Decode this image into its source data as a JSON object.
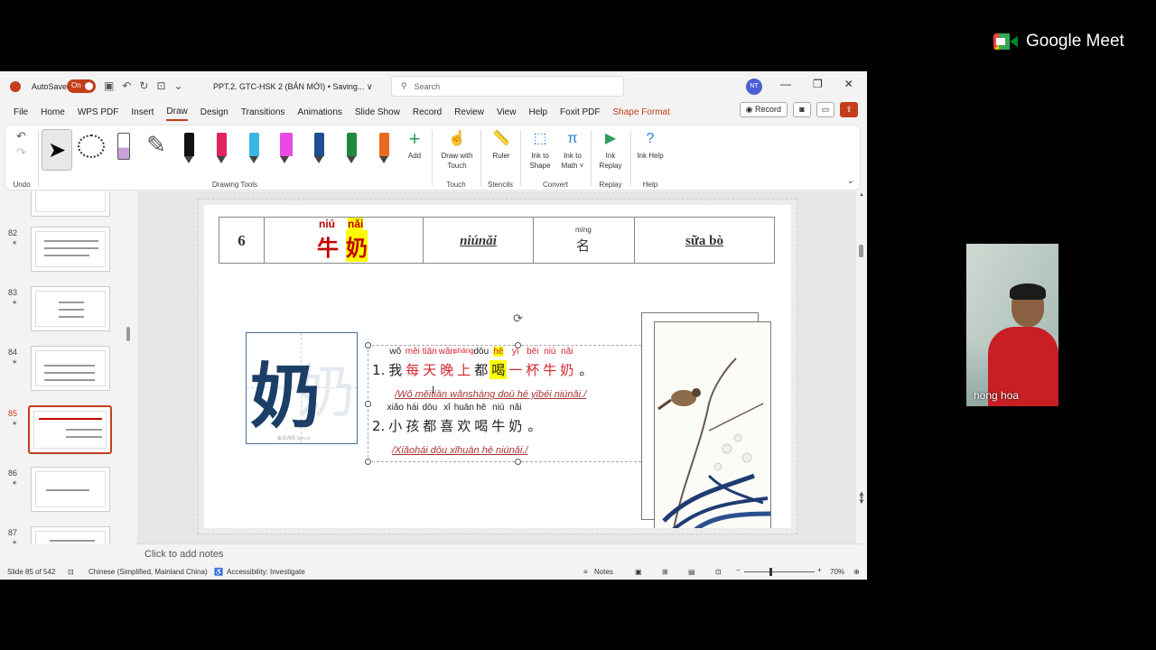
{
  "meet": {
    "brand": "Google Meet",
    "participant_name": "hong hoa"
  },
  "titlebar": {
    "autosave_label": "AutoSave",
    "autosave_state": "On",
    "doc_title": "PPT.2. GTC-HSK 2 (BẢN MỚI) • Saving... ∨",
    "search_placeholder": "Search",
    "user_initials": "NT",
    "minimize": "—",
    "restore": "❐",
    "close": "✕"
  },
  "menu": {
    "items": [
      "File",
      "Home",
      "WPS PDF",
      "Insert",
      "Draw",
      "Design",
      "Transitions",
      "Animations",
      "Slide Show",
      "Record",
      "Review",
      "View",
      "Help",
      "Foxit PDF",
      "Shape Format"
    ],
    "active": "Draw",
    "record_button": "Record"
  },
  "ribbon": {
    "groups": {
      "undo": "Undo",
      "drawing_tools": "Drawing Tools",
      "touch": "Touch",
      "stencils": "Stencils",
      "convert": "Convert",
      "replay": "Replay",
      "help": "Help"
    },
    "add_label": "Add",
    "draw_with_touch": "Draw with Touch",
    "ruler": "Ruler",
    "ink_to_shape": "Ink to Shape",
    "ink_to_math": "Ink to Math ˅",
    "ink_replay": "Ink Replay",
    "ink_help": "Ink Help",
    "pen_colors": [
      "#111111",
      "#e0245e",
      "#39b7e3",
      "#e94ae3",
      "#1d4f91",
      "#1e8a3e",
      "#e96b20"
    ]
  },
  "thumbnails": [
    {
      "num": "82",
      "star": "★"
    },
    {
      "num": "83",
      "star": "★"
    },
    {
      "num": "84",
      "star": "★"
    },
    {
      "num": "85",
      "star": "★"
    },
    {
      "num": "86",
      "star": "★"
    },
    {
      "num": "87",
      "star": "★"
    }
  ],
  "slide": {
    "row": {
      "number": "6",
      "py1": "niú",
      "py2": "nǎi",
      "hz1": "牛",
      "hz2": "奶",
      "word_pinyin": "niúnǎi",
      "pos_pinyin": "míng",
      "pos_hanzi": "名",
      "meaning": "sữa bò"
    },
    "big_char": "奶",
    "grid_watermark": "紫泽通网   2pn.cn",
    "sentence1": {
      "num": "1.",
      "chars": [
        {
          "h": "我",
          "p": "wǒ",
          "c": "dark"
        },
        {
          "h": "每",
          "p": "měi",
          "c": "red"
        },
        {
          "h": "天",
          "p": "tiān",
          "c": "red"
        },
        {
          "h": "晚",
          "p": "wǎn",
          "c": "red"
        },
        {
          "h": "上",
          "p": "shàng",
          "c": "red"
        },
        {
          "h": "都",
          "p": "dōu",
          "c": "dark"
        },
        {
          "h": "喝",
          "p": "hē",
          "c": "hl"
        },
        {
          "h": "一",
          "p": "yì",
          "c": "red"
        },
        {
          "h": "杯",
          "p": "bēi",
          "c": "red"
        },
        {
          "h": "牛",
          "p": "niú",
          "c": "red"
        },
        {
          "h": "奶",
          "p": "nǎi",
          "c": "red"
        }
      ],
      "end": "。",
      "translit": "/Wǒ měitiān wǎnshàng doū hē yībēi niúnǎi./"
    },
    "sentence2": {
      "num": "2.",
      "chars": [
        {
          "h": "小",
          "p": "xiǎo",
          "c": "dark"
        },
        {
          "h": "孩",
          "p": "hái",
          "c": "dark"
        },
        {
          "h": "都",
          "p": "dōu",
          "c": "dark"
        },
        {
          "h": "喜",
          "p": "xǐ",
          "c": "dark"
        },
        {
          "h": "欢",
          "p": "huān",
          "c": "dark"
        },
        {
          "h": "喝",
          "p": "hē",
          "c": "dark"
        },
        {
          "h": "牛",
          "p": "niú",
          "c": "dark"
        },
        {
          "h": "奶",
          "p": "nǎi",
          "c": "dark"
        }
      ],
      "end": "。",
      "translit": "/Xiǎohái dōu xǐhuān hē niúnǎi./"
    }
  },
  "notes_placeholder": "Click to add notes",
  "status": {
    "slide_info": "Slide 85 of 542",
    "language": "Chinese (Simplified, Mainland China)",
    "accessibility": "Accessibility: Investigate",
    "notes_btn": "Notes",
    "zoom": "70%",
    "minus": "−",
    "plus": "+"
  }
}
